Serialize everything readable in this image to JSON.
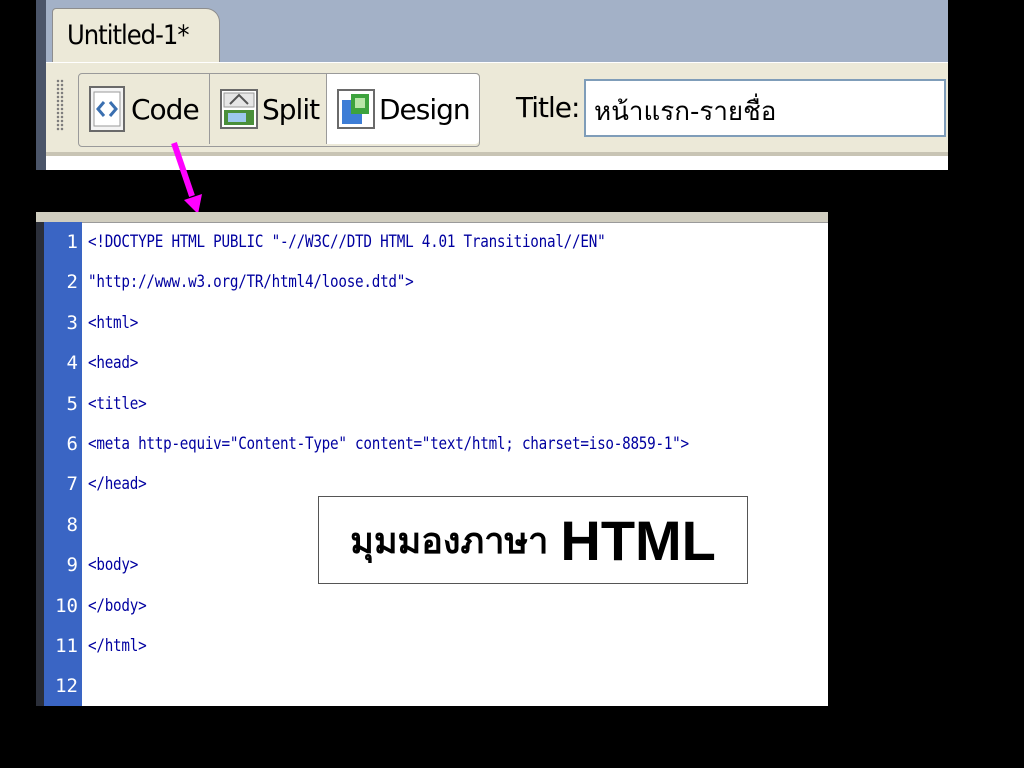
{
  "tab": {
    "title": "Untitled-1*"
  },
  "toolbar": {
    "code_label": "Code",
    "split_label": "Split",
    "design_label": "Design",
    "title_label": "Title:",
    "title_value": "หน้าแรก-รายชื่อ",
    "active_view": "Design"
  },
  "code": {
    "lines": [
      {
        "n": "1",
        "text": "<!DOCTYPE HTML PUBLIC \"-//W3C//DTD HTML 4.01 Transitional//EN\""
      },
      {
        "n": "2",
        "text": "\"http://www.w3.org/TR/html4/loose.dtd\">"
      },
      {
        "n": "3",
        "text": "<html>"
      },
      {
        "n": "4",
        "text": "<head>"
      },
      {
        "n": "5",
        "text": "<title>"
      },
      {
        "n": "6",
        "text": "<meta http-equiv=\"Content-Type\" content=\"text/html; charset=iso-8859-1\">"
      },
      {
        "n": "7",
        "text": "</head>"
      },
      {
        "n": "8",
        "text": ""
      },
      {
        "n": "9",
        "text": "<body>"
      },
      {
        "n": "10",
        "text": "</body>"
      },
      {
        "n": "11",
        "text": "</html>"
      },
      {
        "n": "12",
        "text": ""
      }
    ]
  },
  "caption": {
    "thai": "มุมมองภาษา",
    "html": "HTML"
  },
  "colors": {
    "gutter": "#3a65c4",
    "code_text": "#0000a0",
    "arrow": "#ff00ff",
    "tabstrip": "#a3b1c7",
    "toolbar": "#ece9d8"
  }
}
